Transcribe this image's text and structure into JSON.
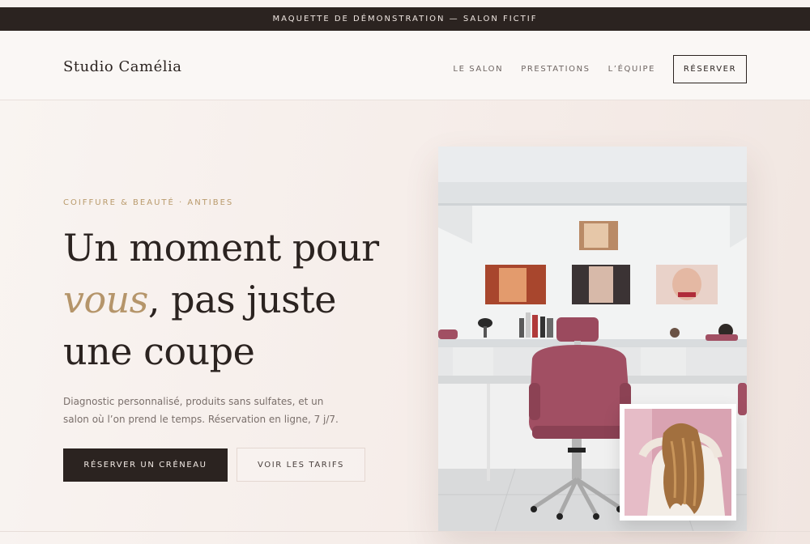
{
  "topbar": {
    "text": "MAQUETTE DE DÉMONSTRATION — SALON FICTIF"
  },
  "header": {
    "logo": "Studio Camélia",
    "nav": [
      "LE SALON",
      "PRESTATIONS",
      "L’ÉQUIPE"
    ],
    "cta": "RÉSERVER"
  },
  "hero": {
    "eyebrow": "COIFFURE & BEAUTÉ · ANTIBES",
    "headline_line1": "Un moment pour",
    "headline_accent": "vous",
    "headline_line2_rest": ", pas juste",
    "headline_line3": "une coupe",
    "description": "Diagnostic personnalisé, produits sans sulfates, et un salon où l’on prend le temps. Réservation en ligne, 7 j/7.",
    "primary_cta": "RÉSERVER UN CRÉNEAU",
    "secondary_cta": "VOIR LES TARIFS"
  },
  "colors": {
    "dark": "#2b2320",
    "accent_gold": "#b5956a",
    "background": "#f7f1ee",
    "chair": "#a14f63"
  }
}
